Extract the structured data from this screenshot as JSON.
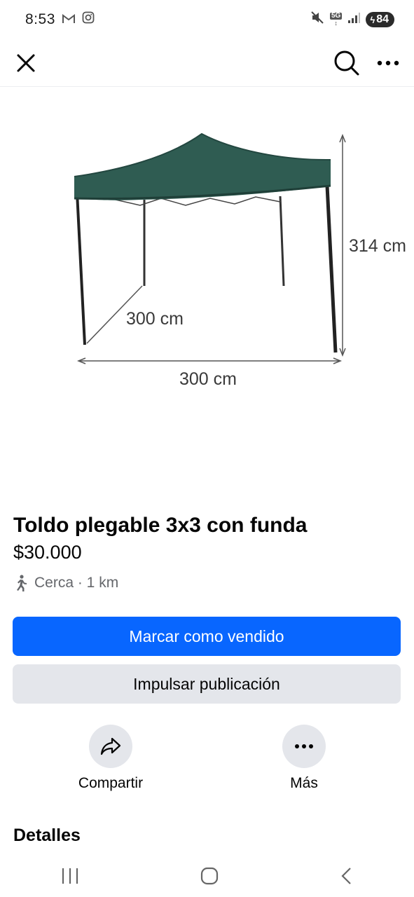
{
  "status_bar": {
    "time": "8:53",
    "battery": "84",
    "network": "5G"
  },
  "listing": {
    "title": "Toldo plegable 3x3 con funda",
    "price": "$30.000",
    "location": "Cerca · 1 km"
  },
  "image": {
    "height_label": "314 cm",
    "depth_label": "300 cm",
    "width_label": "300 cm",
    "canopy_color": "#2f5c52"
  },
  "buttons": {
    "mark_sold": "Marcar como vendido",
    "boost": "Impulsar publicación"
  },
  "actions": {
    "share": "Compartir",
    "more": "Más"
  },
  "sections": {
    "details": "Detalles"
  },
  "colors": {
    "primary": "#0866ff",
    "secondary_bg": "#e4e6eb"
  }
}
